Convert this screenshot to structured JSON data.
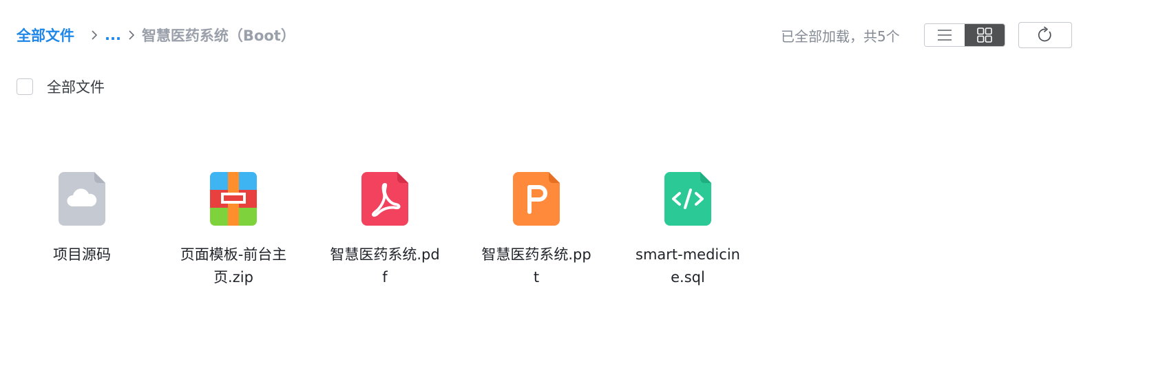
{
  "breadcrumb": {
    "root": "全部文件",
    "ellipsis": "...",
    "current": "智慧医药系统（Boot）"
  },
  "toolbar": {
    "load_status": "已全部加载，共5个",
    "view_modes": [
      "list",
      "grid"
    ],
    "active_view": "grid"
  },
  "select_all": {
    "label": "全部文件",
    "checked": false
  },
  "files": [
    {
      "name": "项目源码",
      "type": "cloud-folder",
      "icon": "cloud-folder-icon",
      "color": "#c5c9d2"
    },
    {
      "name": "页面模板-前台主页.zip",
      "type": "zip",
      "icon": "zip-archive-icon",
      "color": "#e8403f"
    },
    {
      "name": "智慧医药系统.pdf",
      "type": "pdf",
      "icon": "pdf-file-icon",
      "color": "#f2425d"
    },
    {
      "name": "智慧医药系统.ppt",
      "type": "ppt",
      "icon": "ppt-file-icon",
      "color": "#ff8a3c"
    },
    {
      "name": "smart-medicine.sql",
      "type": "code",
      "icon": "code-file-icon",
      "color": "#2bc996"
    }
  ],
  "colors": {
    "accent": "#1f87e8",
    "muted": "#9aa0aa",
    "toggle_active": "#4f5153"
  }
}
